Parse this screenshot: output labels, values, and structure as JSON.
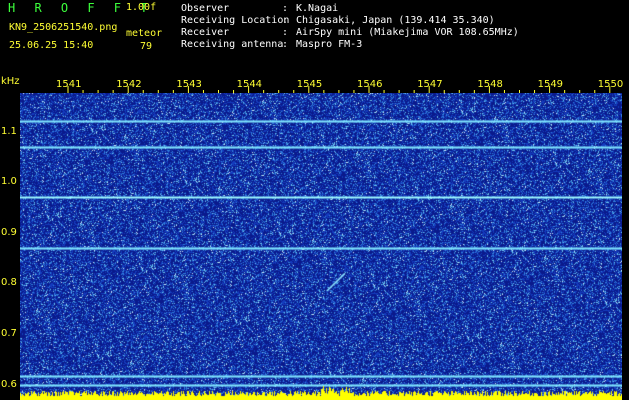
{
  "header": {
    "app_title": "H R O F F T",
    "version": "1.00f",
    "filename": "KN9_2506251540.png",
    "mode": "meteor",
    "datetime": "25.06.25 15:40",
    "count": "79",
    "info": [
      {
        "label": "Observer",
        "value": "K.Nagai"
      },
      {
        "label": "Receiving Location",
        "value": "Chigasaki, Japan (139.414 35.340)"
      },
      {
        "label": "Receiver",
        "value": "AirSpy mini (Miakejima VOR 108.65MHz)"
      },
      {
        "label": "Receiving antenna",
        "value": "Maspro FM-3"
      }
    ],
    "separator": ":"
  },
  "axes": {
    "y_unit": "kHz",
    "x_ticks": [
      "1541",
      "1542",
      "1543",
      "1544",
      "1545",
      "1546",
      "1547",
      "1548",
      "1549",
      "1550"
    ],
    "y_ticks": [
      "1.1",
      "1.0",
      "0.9",
      "0.8",
      "0.7",
      "0.6"
    ]
  },
  "colors": {
    "background": "#0a1a8c",
    "noise": "#4aa0e0",
    "carrier": "#7fe6ff",
    "text_green": "#3cff3c",
    "text_yellow": "#ffff33",
    "level_bar": "#ffff00"
  },
  "signals": {
    "carrier_khz": [
      1.12,
      1.07,
      0.97,
      0.87,
      0.617,
      0.6
    ],
    "meteor_trace": {
      "start_min": 1545.3,
      "end_min": 1545.6,
      "start_khz": 0.785,
      "end_khz": 0.82
    }
  }
}
